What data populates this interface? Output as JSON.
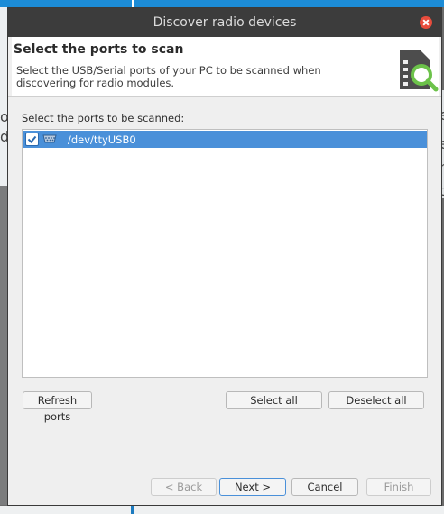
{
  "dialog": {
    "title": "Discover radio devices",
    "header_title": "Select the ports to scan",
    "header_description": "Select the USB/Serial ports of your PC to be scanned when discovering for radio modules.",
    "header_icon": "module-search-icon"
  },
  "ports": {
    "label": "Select the ports to be scanned:",
    "items": [
      {
        "name": "/dev/ttyUSB0",
        "checked": true,
        "icon": "serial-port-icon"
      }
    ]
  },
  "actions": {
    "refresh": "Refresh ports",
    "select_all": "Select all",
    "deselect_all": "Deselect all"
  },
  "wizard": {
    "back": "< Back",
    "next": "Next >",
    "cancel": "Cancel",
    "finish": "Finish"
  },
  "background": {
    "left_chars": [
      "o",
      "d"
    ],
    "right_chars": [
      "e",
      "e",
      "n",
      "t"
    ]
  },
  "colors": {
    "accent": "#4a90d9",
    "titlebar": "#3c3c3c",
    "close": "#e74c3c",
    "background_app": "#1c8cd7"
  }
}
